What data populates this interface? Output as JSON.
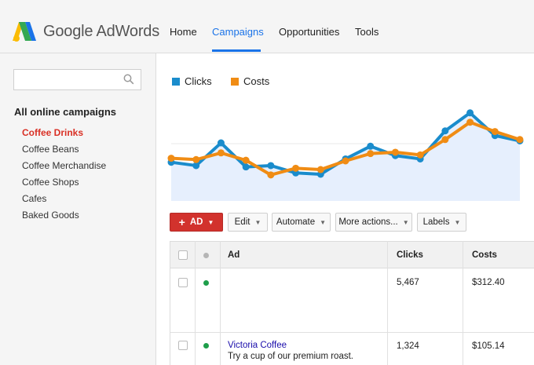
{
  "header": {
    "brand": "Google AdWords",
    "nav": [
      "Home",
      "Campaigns",
      "Opportunities",
      "Tools"
    ],
    "active_nav": "Campaigns"
  },
  "sidebar": {
    "search": {
      "value": "",
      "placeholder": ""
    },
    "heading": "All online campaigns",
    "items": [
      {
        "label": "Coffee Drinks",
        "active": true
      },
      {
        "label": "Coffee Beans"
      },
      {
        "label": "Coffee Merchandise"
      },
      {
        "label": "Coffee Shops"
      },
      {
        "label": "Cafes"
      },
      {
        "label": "Baked Goods"
      }
    ]
  },
  "legend": [
    {
      "label": "Clicks",
      "color": "#1a8ccc"
    },
    {
      "label": "Costs",
      "color": "#f08c14"
    }
  ],
  "chart_data": {
    "type": "line",
    "x": [
      0,
      1,
      2,
      3,
      4,
      5,
      6,
      7,
      8,
      9,
      10,
      11,
      12,
      13,
      14
    ],
    "series": [
      {
        "name": "Clicks",
        "color": "#1a8ccc",
        "values": [
          0.58,
          0.53,
          0.87,
          0.51,
          0.53,
          0.42,
          0.4,
          0.63,
          0.82,
          0.68,
          0.63,
          1.05,
          1.32,
          0.98,
          0.9
        ]
      },
      {
        "name": "Costs",
        "color": "#f08c14",
        "values": [
          0.64,
          0.62,
          0.72,
          0.61,
          0.39,
          0.49,
          0.47,
          0.6,
          0.71,
          0.73,
          0.69,
          0.92,
          1.18,
          1.04,
          0.92
        ]
      }
    ],
    "ylim": [
      0,
      1.6
    ],
    "grid": false
  },
  "toolbar": {
    "add_label": "AD",
    "buttons": [
      "Edit",
      "Automate",
      "More actions...",
      "Labels"
    ]
  },
  "table": {
    "columns": [
      "Ad",
      "Clicks",
      "Costs"
    ],
    "rows": [
      {
        "title": "",
        "desc": "",
        "clicks": "5,467",
        "costs": "$312.40",
        "status_color": "#1e9e4a"
      },
      {
        "title": "Victoria Coffee",
        "desc": "Try a cup of our premium roast.",
        "clicks": "1,324",
        "costs": "$105.14",
        "status_color": "#1e9e4a"
      }
    ]
  }
}
